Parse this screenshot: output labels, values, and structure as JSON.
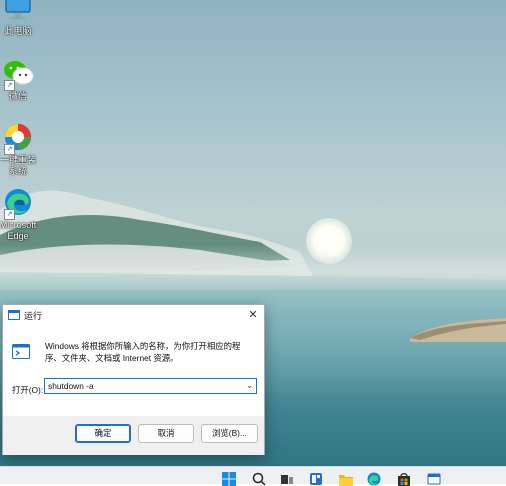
{
  "desktop": {
    "icons": [
      {
        "label": "此电脑",
        "icon": "computer-icon"
      },
      {
        "label": "微信",
        "icon": "wechat-icon"
      },
      {
        "label_line1": "一键重装",
        "label_line2": "系统",
        "icon": "reinstall-icon"
      },
      {
        "label_line1": "Microsoft",
        "label_line2": "Edge",
        "icon": "edge-icon"
      }
    ]
  },
  "run_dialog": {
    "title": "运行",
    "description": "Windows 将根据你所输入的名称，为你打开相应的程序、文件夹、文档或 Internet 资源。",
    "open_label": "打开(O):",
    "open_value": "shutdown -a",
    "buttons": {
      "ok": "确定",
      "cancel": "取消",
      "browse": "浏览(B)..."
    }
  },
  "taskbar": {
    "icons": [
      "windows-start-icon",
      "search-icon",
      "task-view-icon",
      "widgets-icon",
      "file-explorer-icon",
      "edge-icon",
      "store-icon",
      "taskbar-app-icon"
    ]
  },
  "colors": {
    "accent": "#1a6fd1",
    "dialog_bg": "#f0f0f0",
    "taskbar_bg": "#eef1f4"
  }
}
